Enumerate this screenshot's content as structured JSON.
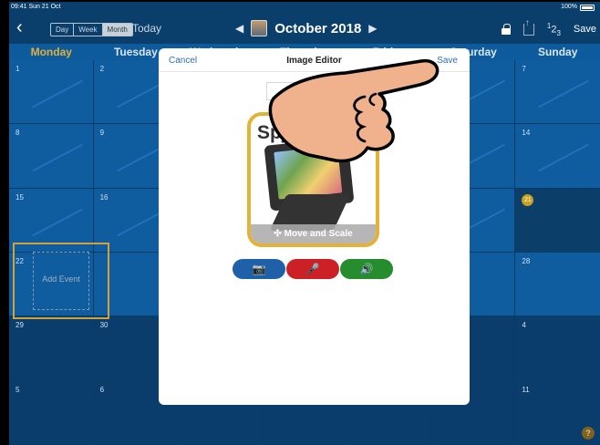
{
  "status": {
    "time": "09:41",
    "date": "Sun 21 Oct",
    "battery": "100%"
  },
  "toolbar": {
    "views": [
      "Day",
      "Week",
      "Month"
    ],
    "active_view": "Month",
    "today_label": "Today",
    "month_title": "October 2018",
    "save_label": "Save"
  },
  "weekdays": [
    "Monday",
    "Tuesday",
    "Wednesday",
    "Thursday",
    "Friday",
    "Saturday",
    "Sunday"
  ],
  "calendar_numbers": {
    "r1": [
      "1",
      "2",
      "",
      "",
      "",
      "",
      "7"
    ],
    "r2": [
      "8",
      "9",
      "",
      "",
      "",
      "",
      "14"
    ],
    "r3": [
      "15",
      "16",
      "",
      "",
      "",
      "",
      "21"
    ],
    "r4": [
      "22",
      "",
      "",
      "",
      "",
      "",
      "28"
    ],
    "r5": [
      "29",
      "30",
      "",
      "",
      "",
      "",
      "4"
    ],
    "r6": [
      "5",
      "6",
      "",
      "",
      "",
      "",
      "11"
    ]
  },
  "add_event": {
    "label": "Add Event"
  },
  "modal": {
    "cancel": "Cancel",
    "title": "Image Editor",
    "save": "Save",
    "name_value": "Spjalc",
    "image_title": "Spj",
    "move_scale": "Move and Scale"
  },
  "icons": [
    "back-icon",
    "lock-icon",
    "share-icon",
    "number-icon",
    "camera-icon",
    "microphone-icon",
    "speaker-icon",
    "help-icon"
  ]
}
